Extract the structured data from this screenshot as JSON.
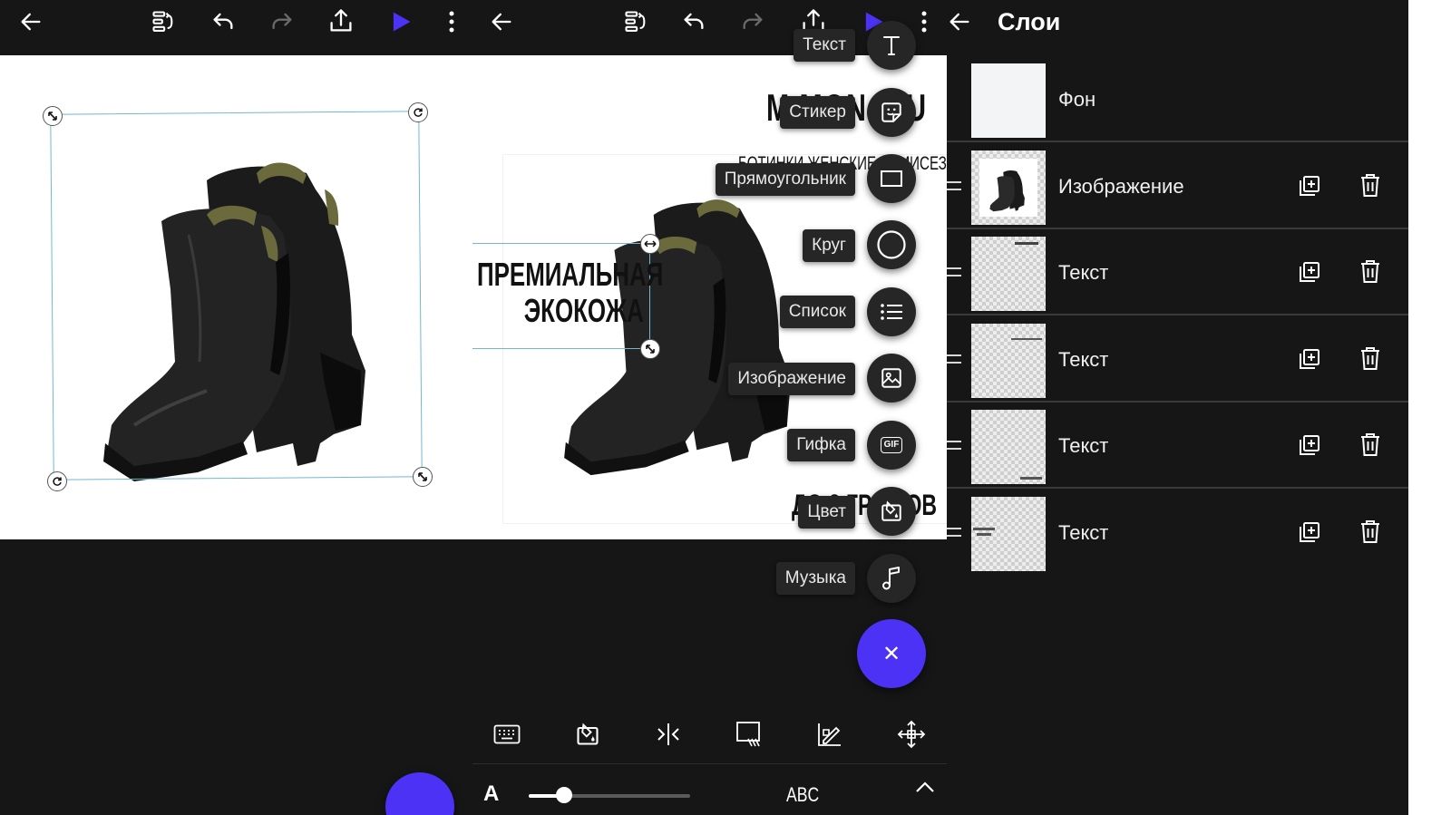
{
  "colors": {
    "accent": "#4b32f5",
    "background": "#161616",
    "selection": "#6fb9cf"
  },
  "toolbar": {
    "icons": [
      "back-arrow-icon",
      "layers-toggle-icon",
      "undo-icon",
      "redo-icon",
      "share-icon",
      "play-icon",
      "more-vert-icon"
    ]
  },
  "canvas": {
    "headline_line1": "ПРЕМИАЛЬНАЯ",
    "headline_line2": "ЭКОКОЖА",
    "brand_partial": "M  MON  D U",
    "subtitle_partial": "БОТИНКИ ЖЕНСКИЕ ДЕМИСЕЗОН",
    "bottom_partial": "ДО 2 ГРА   СОВ"
  },
  "add_menu": {
    "items": [
      {
        "label": "Текст",
        "icon": "text-icon"
      },
      {
        "label": "Стикер",
        "icon": "sticker-icon"
      },
      {
        "label": "Прямоугольник",
        "icon": "rectangle-icon"
      },
      {
        "label": "Круг",
        "icon": "circle-icon"
      },
      {
        "label": "Список",
        "icon": "list-icon"
      },
      {
        "label": "Изображение",
        "icon": "image-icon"
      },
      {
        "label": "Гифка",
        "icon": "gif-icon",
        "glyph": "GIF"
      },
      {
        "label": "Цвет",
        "icon": "color-fill-icon"
      },
      {
        "label": "Музыка",
        "icon": "music-note-icon"
      }
    ],
    "close_glyph": "✕"
  },
  "bottom_tools": {
    "icons": [
      "keyboard-icon",
      "color-fill-icon",
      "align-center-icon",
      "text-box-icon",
      "style-icon",
      "move-icon"
    ],
    "font_size_glyph": "A",
    "abc_label": "ABC"
  },
  "layers": {
    "title": "Слои",
    "items": [
      {
        "name": "Фон"
      },
      {
        "name": "Изображение"
      },
      {
        "name": "Текст"
      },
      {
        "name": "Текст"
      },
      {
        "name": "Текст"
      },
      {
        "name": "Текст"
      }
    ]
  }
}
